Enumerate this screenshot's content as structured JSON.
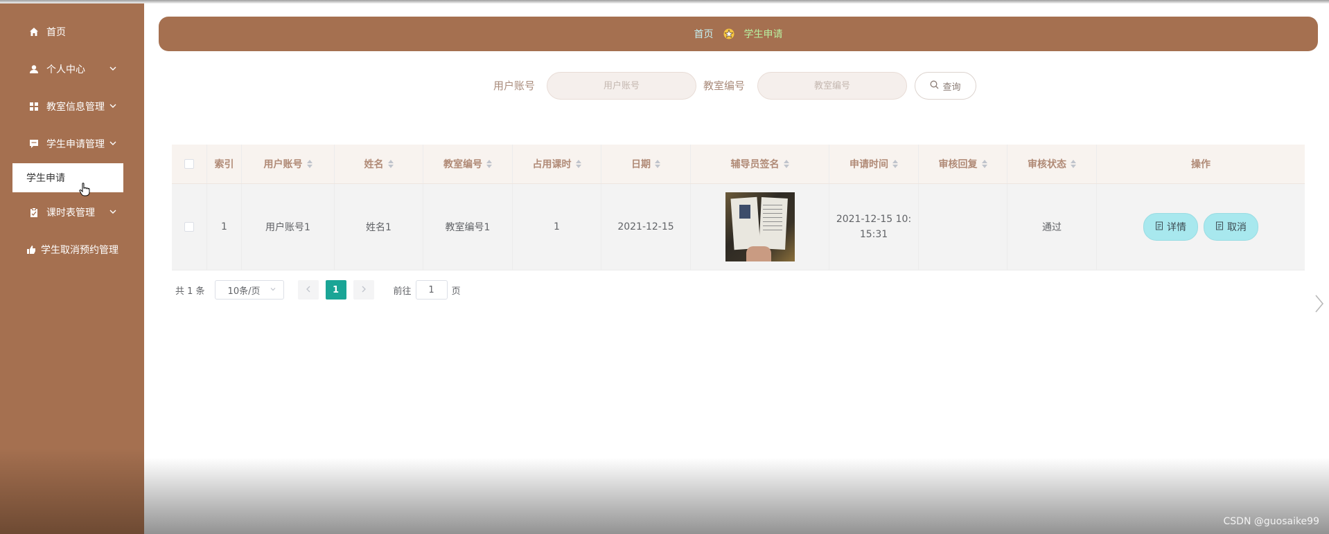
{
  "sidebar": {
    "items": [
      {
        "label": "首页",
        "icon": "home-icon"
      },
      {
        "label": "个人中心",
        "icon": "user-icon"
      },
      {
        "label": "教室信息管理",
        "icon": "grid-icon"
      },
      {
        "label": "学生申请管理",
        "icon": "chat-icon"
      },
      {
        "label": "课时表管理",
        "icon": "clipboard-icon"
      },
      {
        "label": "学生取消预约管理",
        "icon": "thumb-icon"
      }
    ],
    "active_sub": "学生申请"
  },
  "breadcrumb": {
    "home": "首页",
    "current": "学生申请"
  },
  "search": {
    "user_label": "用户账号",
    "user_placeholder": "用户账号",
    "room_label": "教室编号",
    "room_placeholder": "教室编号",
    "button": "查询"
  },
  "table": {
    "headers": [
      "索引",
      "用户账号",
      "姓名",
      "教室编号",
      "占用课时",
      "日期",
      "辅导员签名",
      "申请时间",
      "审核回复",
      "审核状态",
      "操作"
    ],
    "rows": [
      {
        "index": "1",
        "user": "用户账号1",
        "name": "姓名1",
        "room": "教室编号1",
        "hours": "1",
        "date": "2021-12-15",
        "apply_time_line1": "2021-12-15 10:",
        "apply_time_line2": "15:31",
        "reply": "",
        "status": "通过",
        "detail_btn": "详情",
        "cancel_btn": "取消"
      }
    ]
  },
  "pagination": {
    "total": "共 1 条",
    "page_size": "10条/页",
    "current_page": "1",
    "goto_label": "前往",
    "goto_value": "1",
    "page_suffix": "页"
  },
  "watermark": "CSDN @guosaike99",
  "colors": {
    "sidebar": "#a57050",
    "accent_teal": "#1aa596",
    "button_cyan": "#a8e8ee"
  }
}
